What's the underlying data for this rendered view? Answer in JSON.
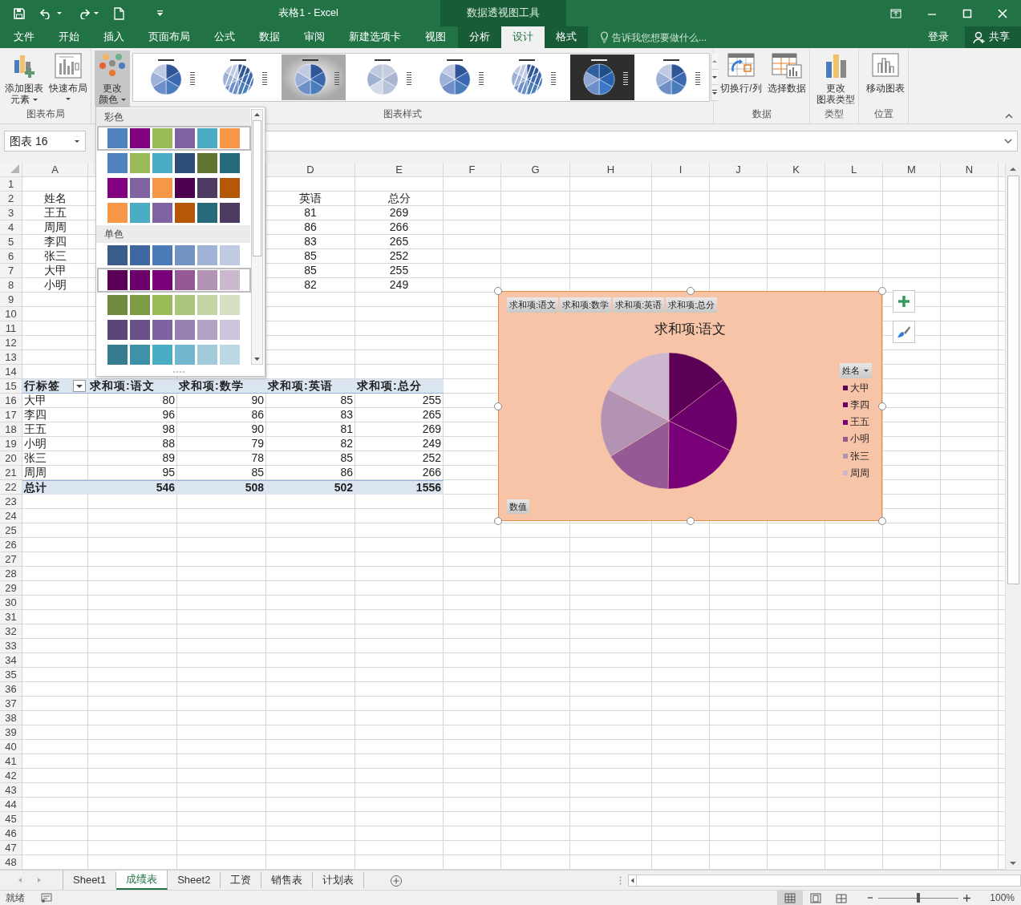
{
  "window": {
    "title": "表格1 - Excel",
    "context_group": "数据透视图工具"
  },
  "menu_tabs": [
    {
      "label": "文件",
      "selected": false,
      "context": false
    },
    {
      "label": "开始",
      "selected": false,
      "context": false
    },
    {
      "label": "插入",
      "selected": false,
      "context": false
    },
    {
      "label": "页面布局",
      "selected": false,
      "context": false
    },
    {
      "label": "公式",
      "selected": false,
      "context": false
    },
    {
      "label": "数据",
      "selected": false,
      "context": false
    },
    {
      "label": "审阅",
      "selected": false,
      "context": false
    },
    {
      "label": "新建选项卡",
      "selected": false,
      "context": false
    },
    {
      "label": "视图",
      "selected": false,
      "context": false
    },
    {
      "label": "分析",
      "selected": false,
      "context": true
    },
    {
      "label": "设计",
      "selected": true,
      "context": true
    },
    {
      "label": "格式",
      "selected": false,
      "context": true
    }
  ],
  "tell_me": {
    "placeholder": "告诉我您想要做什么..."
  },
  "sign_in": "登录",
  "share": "共享",
  "ribbon": {
    "groups": [
      {
        "label": "图表布局",
        "buttons": [
          {
            "kind": "add_element",
            "lines": [
              "添加图表",
              "元素"
            ],
            "dropdown": true,
            "pressed": false
          },
          {
            "kind": "quick_layout",
            "lines": [
              "快速布局"
            ],
            "dropdown": true,
            "pressed": false
          }
        ]
      },
      {
        "label": "图表样式",
        "buttons": [
          {
            "kind": "change_colors",
            "lines": [
              "更改",
              "颜色"
            ],
            "dropdown": true,
            "pressed": true
          }
        ],
        "gallery": [
          {
            "kind": "plain"
          },
          {
            "kind": "hatched"
          },
          {
            "kind": "gray"
          },
          {
            "kind": "light"
          },
          {
            "kind": "plain"
          },
          {
            "kind": "hatched"
          },
          {
            "kind": "dark"
          },
          {
            "kind": "plain"
          }
        ]
      },
      {
        "label": "数据",
        "buttons": [
          {
            "kind": "switch_row_col",
            "lines": [
              "切换行/列"
            ],
            "dropdown": false,
            "pressed": false
          },
          {
            "kind": "select_data",
            "lines": [
              "选择数据"
            ],
            "dropdown": false,
            "pressed": false
          }
        ]
      },
      {
        "label": "类型",
        "buttons": [
          {
            "kind": "change_type",
            "lines": [
              "更改",
              "图表类型"
            ],
            "dropdown": false,
            "pressed": false
          }
        ]
      },
      {
        "label": "位置",
        "buttons": [
          {
            "kind": "move_chart",
            "lines": [
              "移动图表"
            ],
            "dropdown": false,
            "pressed": false
          }
        ]
      }
    ]
  },
  "name_box": "图表 16",
  "color_menu": {
    "sections": [
      {
        "label": "彩色",
        "rows": [
          {
            "selected": true,
            "swatches": [
              {
                "color": "#4f81bd"
              },
              {
                "color": "#800080"
              },
              {
                "color": "#9bbb59"
              },
              {
                "color": "#8064a2"
              },
              {
                "color": "#4bacc6"
              },
              {
                "color": "#f79646"
              }
            ]
          },
          {
            "selected": false,
            "swatches": [
              {
                "color": "#4f81bd"
              },
              {
                "color": "#9bbb59"
              },
              {
                "color": "#4bacc6"
              },
              {
                "color": "#2c4d75"
              },
              {
                "color": "#5f7530"
              },
              {
                "color": "#276a7c"
              }
            ]
          },
          {
            "selected": false,
            "swatches": [
              {
                "color": "#800080"
              },
              {
                "color": "#8064a2"
              },
              {
                "color": "#f79646"
              },
              {
                "color": "#4d004d"
              },
              {
                "color": "#4d3b62"
              },
              {
                "color": "#b65708"
              }
            ]
          },
          {
            "selected": false,
            "swatches": [
              {
                "color": "#f79646"
              },
              {
                "color": "#4bacc6"
              },
              {
                "color": "#8064a2"
              },
              {
                "color": "#b65708"
              },
              {
                "color": "#276a7c"
              },
              {
                "color": "#4d3b62"
              }
            ]
          }
        ]
      },
      {
        "label": "单色",
        "rows": [
          {
            "selected": false,
            "swatches": [
              {
                "color": "#3a5c8b"
              },
              {
                "color": "#3f67a0"
              },
              {
                "color": "#4a7ab8"
              },
              {
                "color": "#7393c5"
              },
              {
                "color": "#a0b3d6"
              },
              {
                "color": "#c0cbe3"
              }
            ]
          },
          {
            "selected": true,
            "swatches": [
              {
                "color": "#5c0057"
              },
              {
                "color": "#6b006b"
              },
              {
                "color": "#7a007a"
              },
              {
                "color": "#955a95"
              },
              {
                "color": "#b393b3"
              },
              {
                "color": "#cbb8cf"
              }
            ]
          },
          {
            "selected": false,
            "swatches": [
              {
                "color": "#6e8b3d"
              },
              {
                "color": "#7f9c45"
              },
              {
                "color": "#9bbb59"
              },
              {
                "color": "#adc47d"
              },
              {
                "color": "#c3d4a5"
              },
              {
                "color": "#d6e0c2"
              }
            ]
          },
          {
            "selected": false,
            "swatches": [
              {
                "color": "#5a4778"
              },
              {
                "color": "#6a5189"
              },
              {
                "color": "#7f62a0"
              },
              {
                "color": "#9580b1"
              },
              {
                "color": "#b0a3c6"
              },
              {
                "color": "#cdc5dc"
              }
            ]
          },
          {
            "selected": false,
            "swatches": [
              {
                "color": "#367c8f"
              },
              {
                "color": "#3e91a7"
              },
              {
                "color": "#4bacc6"
              },
              {
                "color": "#72b7ce"
              },
              {
                "color": "#a1cadb"
              },
              {
                "color": "#bcd8e4"
              }
            ]
          }
        ]
      }
    ]
  },
  "column_headers": [
    "A",
    "D",
    "E",
    "F",
    "G",
    "H",
    "I",
    "J",
    "K",
    "L",
    "M",
    "N"
  ],
  "row_numbers": [
    "1",
    "2",
    "3",
    "4",
    "5",
    "6",
    "7",
    "8",
    "9",
    "10",
    "11",
    "12",
    "13",
    "14",
    "15",
    "16",
    "17",
    "18",
    "19",
    "20",
    "21",
    "22",
    "23",
    "24",
    "25",
    "26",
    "27",
    "28",
    "29",
    "30",
    "31",
    "32",
    "33",
    "34",
    "35",
    "36",
    "37",
    "38",
    "39",
    "40",
    "41",
    "42",
    "43",
    "44",
    "45",
    "46",
    "47",
    "48"
  ],
  "source_table": {
    "header": [
      "姓名",
      "英语",
      "总分"
    ],
    "rows": [
      [
        "王五",
        "81",
        "269"
      ],
      [
        "周周",
        "86",
        "266"
      ],
      [
        "李四",
        "83",
        "265"
      ],
      [
        "张三",
        "85",
        "252"
      ],
      [
        "大甲",
        "85",
        "255"
      ],
      [
        "小明",
        "82",
        "249"
      ]
    ]
  },
  "pivot_table": {
    "header": [
      "行标签",
      "求和项:语文",
      "求和项:数学",
      "求和项:英语",
      "求和项:总分"
    ],
    "rows": [
      [
        "大甲",
        "80",
        "90",
        "85",
        "255"
      ],
      [
        "李四",
        "96",
        "86",
        "83",
        "265"
      ],
      [
        "王五",
        "98",
        "90",
        "81",
        "269"
      ],
      [
        "小明",
        "88",
        "79",
        "82",
        "249"
      ],
      [
        "张三",
        "89",
        "78",
        "85",
        "252"
      ],
      [
        "周周",
        "95",
        "85",
        "86",
        "266"
      ]
    ],
    "total": [
      "总计",
      "546",
      "508",
      "502",
      "1556"
    ]
  },
  "chart": {
    "selected": true,
    "field_buttons": [
      "求和项:语文",
      "求和项:数学",
      "求和项:英语",
      "求和项:总分"
    ],
    "legend_field": "姓名",
    "legend": [
      {
        "color": "#5c0057"
      },
      {
        "color": "#6b006b"
      },
      {
        "color": "#7a007a"
      },
      {
        "color": "#955a95"
      },
      {
        "color": "#b393b3"
      },
      {
        "color": "#cbb8cf"
      }
    ],
    "axis_field": "数值",
    "chart_data": {
      "type": "pie",
      "title": "求和项:语文",
      "categories": [
        "大甲",
        "李四",
        "王五",
        "小明",
        "张三",
        "周周"
      ],
      "series": [
        {
          "values": [
            14.65,
            17.58,
            17.95,
            16.12,
            16.3,
            17.4
          ]
        }
      ]
    }
  },
  "sheet_tabs": [
    {
      "label": "Sheet1",
      "selected": false
    },
    {
      "label": "成绩表",
      "selected": true
    },
    {
      "label": "Sheet2",
      "selected": false
    },
    {
      "label": "工资",
      "selected": false
    },
    {
      "label": "销售表",
      "selected": false
    },
    {
      "label": "计划表",
      "selected": false
    }
  ],
  "status": "就绪",
  "views": [
    {
      "kind": "normal",
      "selected": true
    },
    {
      "kind": "page_layout",
      "selected": false
    },
    {
      "kind": "page_break",
      "selected": false
    }
  ],
  "zoom": {
    "level": 0.5,
    "label": "100%"
  }
}
